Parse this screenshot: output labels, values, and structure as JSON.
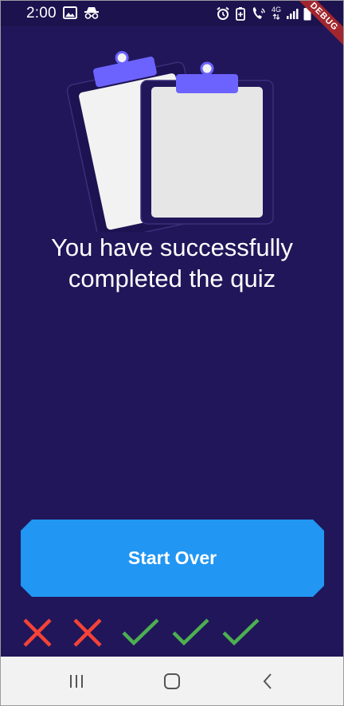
{
  "status_bar": {
    "time": "2:00",
    "network": "4G",
    "debug_banner": "DEBUG",
    "icons_left": [
      "image-icon",
      "incognito-icon"
    ],
    "icons_right": [
      "alarm-icon",
      "battery-saver-icon",
      "wifi-calling-icon",
      "signal-icon",
      "battery-icon"
    ]
  },
  "illustration": {
    "name": "clipboards-illustration",
    "colors": {
      "clip": "#6c63ff",
      "paper_back": "#f2f2f2",
      "paper_front": "#e6e6e6",
      "board": "#2a1f66"
    }
  },
  "main": {
    "message": "You have successfully completed the quiz"
  },
  "actions": {
    "start_over_label": "Start Over"
  },
  "score": [
    {
      "result": "wrong",
      "icon": "x-icon",
      "color": "#f44336"
    },
    {
      "result": "wrong",
      "icon": "x-icon",
      "color": "#f44336"
    },
    {
      "result": "correct",
      "icon": "check-icon",
      "color": "#4caf50"
    },
    {
      "result": "correct",
      "icon": "check-icon",
      "color": "#4caf50"
    },
    {
      "result": "correct",
      "icon": "check-icon",
      "color": "#4caf50"
    }
  ],
  "nav_bar": {
    "buttons": [
      "recent-apps-icon",
      "home-icon",
      "back-icon"
    ]
  },
  "colors": {
    "background": "#21165a",
    "status_bar": "#1c124e",
    "button": "#2196f3",
    "nav_bar": "#f2f2f2"
  }
}
